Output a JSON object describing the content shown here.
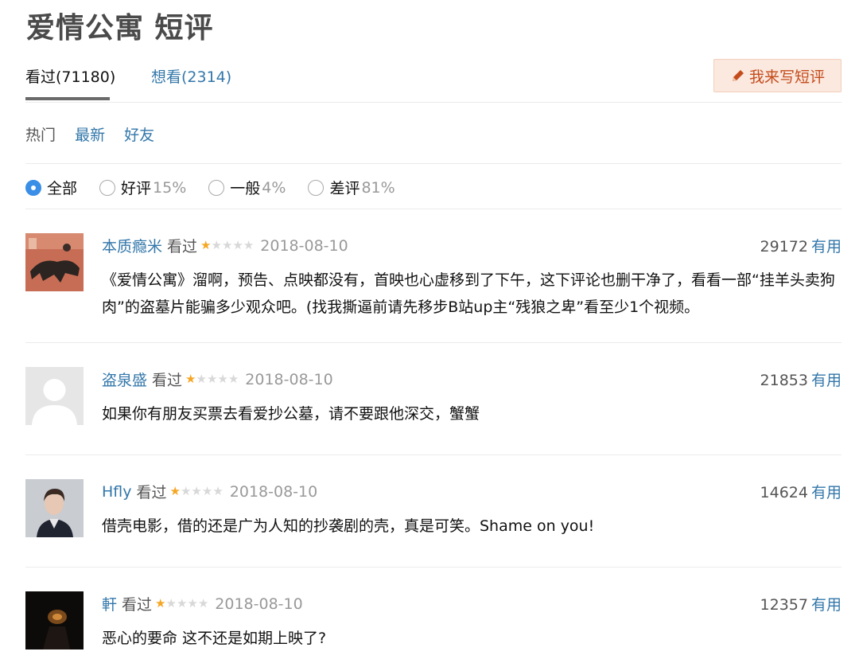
{
  "page": {
    "title": "爱情公寓 短评"
  },
  "tabs": {
    "watched": "看过(71180)",
    "want": "想看(2314)",
    "write_button": "我来写短评"
  },
  "sort": {
    "hot": "热门",
    "latest": "最新",
    "friends": "好友"
  },
  "filters": [
    {
      "label": "全部",
      "pct": "",
      "checked": true
    },
    {
      "label": "好评",
      "pct": "15%",
      "checked": false
    },
    {
      "label": "一般",
      "pct": "4%",
      "checked": false
    },
    {
      "label": "差评",
      "pct": "81%",
      "checked": false
    }
  ],
  "comments": [
    {
      "user": "本质瘾米",
      "status": "看过",
      "rating": 1,
      "date": "2018-08-10",
      "votes": "29172",
      "useful": "有用",
      "text": "《爱情公寓》溜啊，预告、点映都没有，首映也心虚移到了下午，这下评论也删干净了，看看一部“挂羊头卖狗肉”的盗墓片能骗多少观众吧。(找我撕逼前请先移步B站up主“残狼之卑”看至少1个视频。"
    },
    {
      "user": "盗泉盛",
      "status": "看过",
      "rating": 1,
      "date": "2018-08-10",
      "votes": "21853",
      "useful": "有用",
      "text": "如果你有朋友买票去看爱抄公墓，请不要跟他深交，蟹蟹"
    },
    {
      "user": "Hfly",
      "status": "看过",
      "rating": 1,
      "date": "2018-08-10",
      "votes": "14624",
      "useful": "有用",
      "text": "借壳电影，借的还是广为人知的抄袭剧的壳，真是可笑。Shame on you!"
    },
    {
      "user": "軒",
      "status": "看过",
      "rating": 1,
      "date": "2018-08-10",
      "votes": "12357",
      "useful": "有用",
      "text": "恶心的要命 这不还是如期上映了?"
    }
  ],
  "colors": {
    "link": "#3377aa",
    "star": "#f5a623",
    "accent_button": "#fbe8de"
  }
}
